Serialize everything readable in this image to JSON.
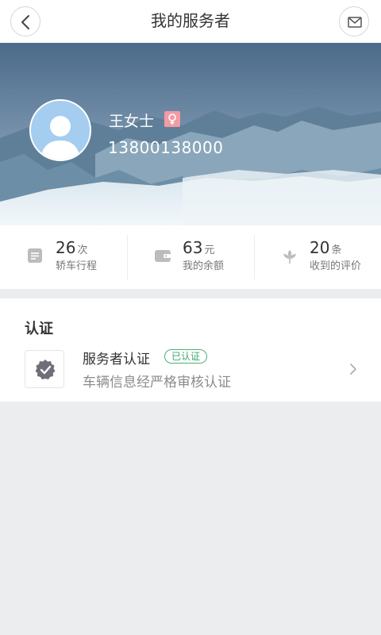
{
  "header": {
    "title": "我的服务者"
  },
  "profile": {
    "name": "王女士",
    "phone": "13800138000"
  },
  "stats": [
    {
      "value": "26",
      "unit": "次",
      "label": "轿车行程",
      "icon": "list-icon"
    },
    {
      "value": "63",
      "unit": "元",
      "label": "我的余额",
      "icon": "wallet-icon"
    },
    {
      "value": "20",
      "unit": "条",
      "label": "收到的评价",
      "icon": "flower-icon"
    }
  ],
  "certification": {
    "section_title": "认证",
    "item_name": "服务者认证",
    "badge": "已认证",
    "description": "车辆信息经严格审核认证"
  },
  "colors": {
    "verified_green": "#3ca56e",
    "female_badge": "#f39aa5",
    "background": "#ecedef"
  }
}
